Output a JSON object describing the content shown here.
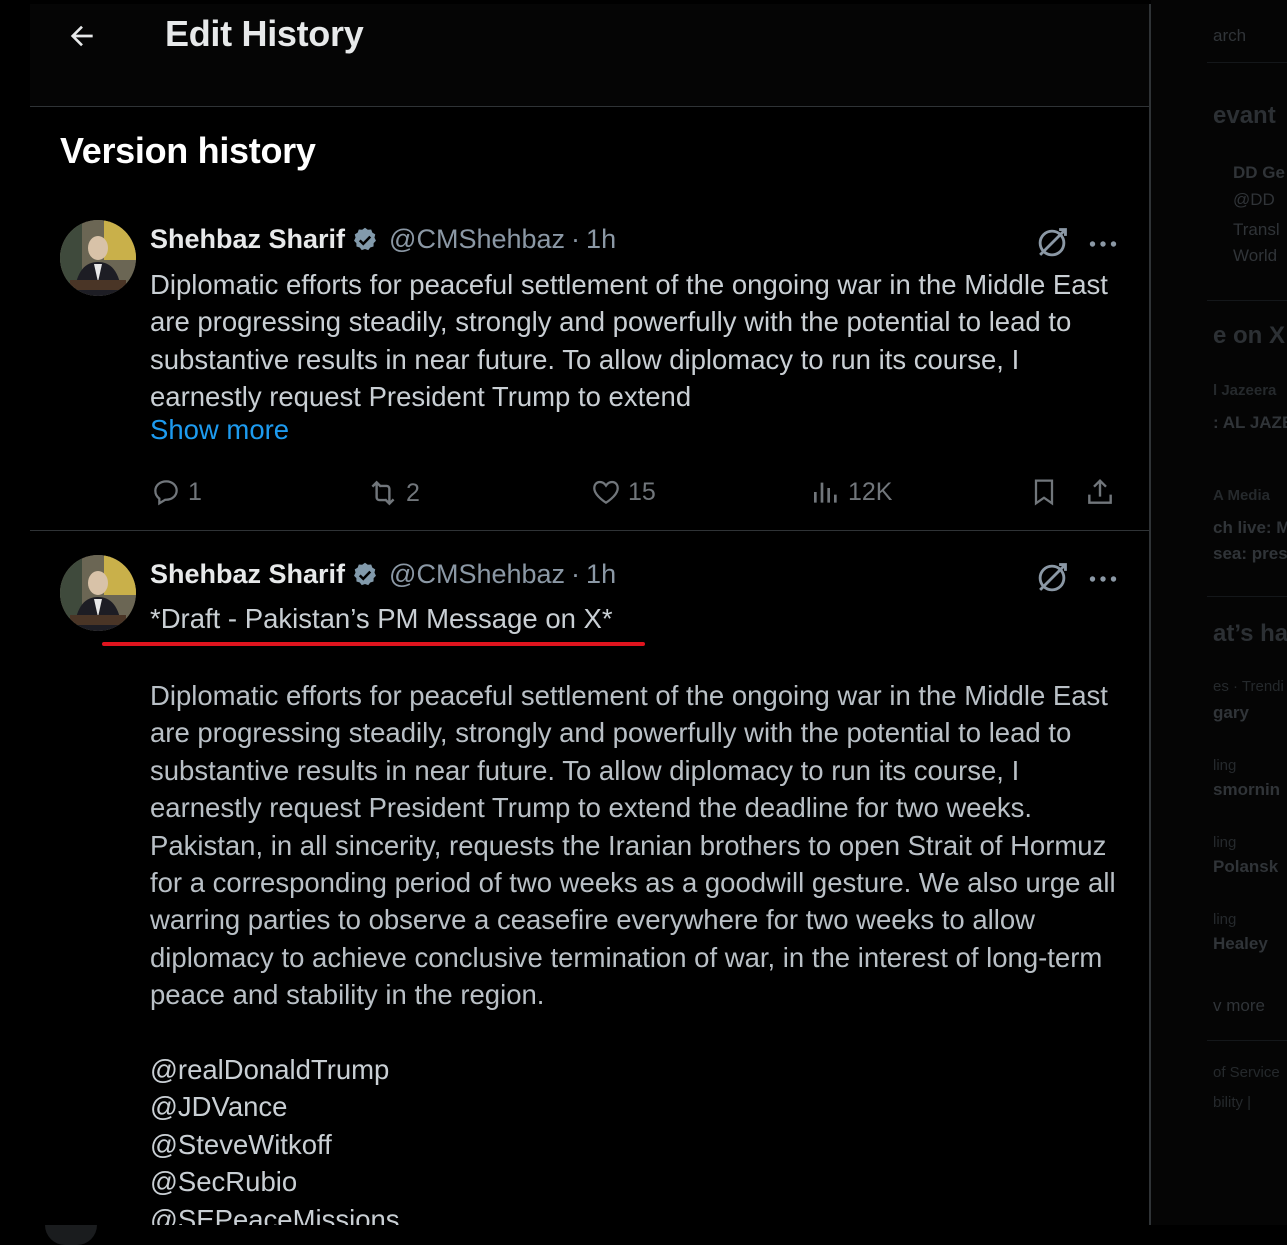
{
  "header": {
    "title": "Edit History"
  },
  "section": {
    "title": "Version history"
  },
  "posts": [
    {
      "author": "Shehbaz Sharif",
      "handle": "@CMShehbaz",
      "dot": "·",
      "time": "1h",
      "text": "Diplomatic efforts for peaceful settlement of the ongoing war in the Middle East are progressing steadily, strongly and powerfully with the potential to lead to substantive results in near future. To allow diplomacy to run its course, I earnestly request President Trump to extend",
      "show_more": "Show more",
      "stats": {
        "replies": "1",
        "reposts": "2",
        "likes": "15",
        "views": "12K"
      }
    },
    {
      "author": "Shehbaz Sharif",
      "handle": "@CMShehbaz",
      "dot": "·",
      "time": "1h",
      "draft_line": "*Draft - Pakistan’s PM Message on X*",
      "text": "Diplomatic efforts for peaceful settlement of the ongoing war in the Middle East are progressing steadily, strongly and powerfully with the potential to lead to substantive results in near future. To allow diplomacy to run its course, I earnestly request President Trump to extend the deadline for two weeks. Pakistan, in all sincerity, requests the Iranian brothers to open Strait of Hormuz for a corresponding period of two weeks as a goodwill gesture. We also urge all warring parties to observe a ceasefire everywhere for two weeks to allow diplomacy to achieve conclusive termination of war, in the interest of long-term peace and stability in the region.",
      "mentions": [
        "@realDonaldTrump",
        "@JDVance",
        "@SteveWitkoff",
        "@SecRubio",
        "@SEPeaceMissions"
      ]
    }
  ],
  "sidebar": {
    "search_fragment": "arch",
    "relevant_fragment": "evant",
    "account_name": "DD Ge",
    "account_handle": "@DD",
    "account_line1": "Transl",
    "account_line2": "World",
    "live_fragment": "e on X",
    "live1_source": "l Jazeera",
    "live1_title": ": AL JAZE",
    "live2_source": "A Media",
    "live2_title1": "ch live: M",
    "live2_title2": "sea: pres",
    "happening_fragment": "at’s ha",
    "trend1_context": "es · Trendi",
    "trend1_title": "gary",
    "trend2_context": "ling",
    "trend2_title": "smornin",
    "trend3_context": "ling",
    "trend3_title": "Polansk",
    "trend4_context": "ling",
    "trend4_title": "Healey",
    "show_more_fragment": "v more",
    "footer1": "of Service",
    "footer2": "bility | "
  },
  "colors": {
    "accent": "#1d9bf0",
    "underline": "#e0141e",
    "verified": "#829aab"
  }
}
